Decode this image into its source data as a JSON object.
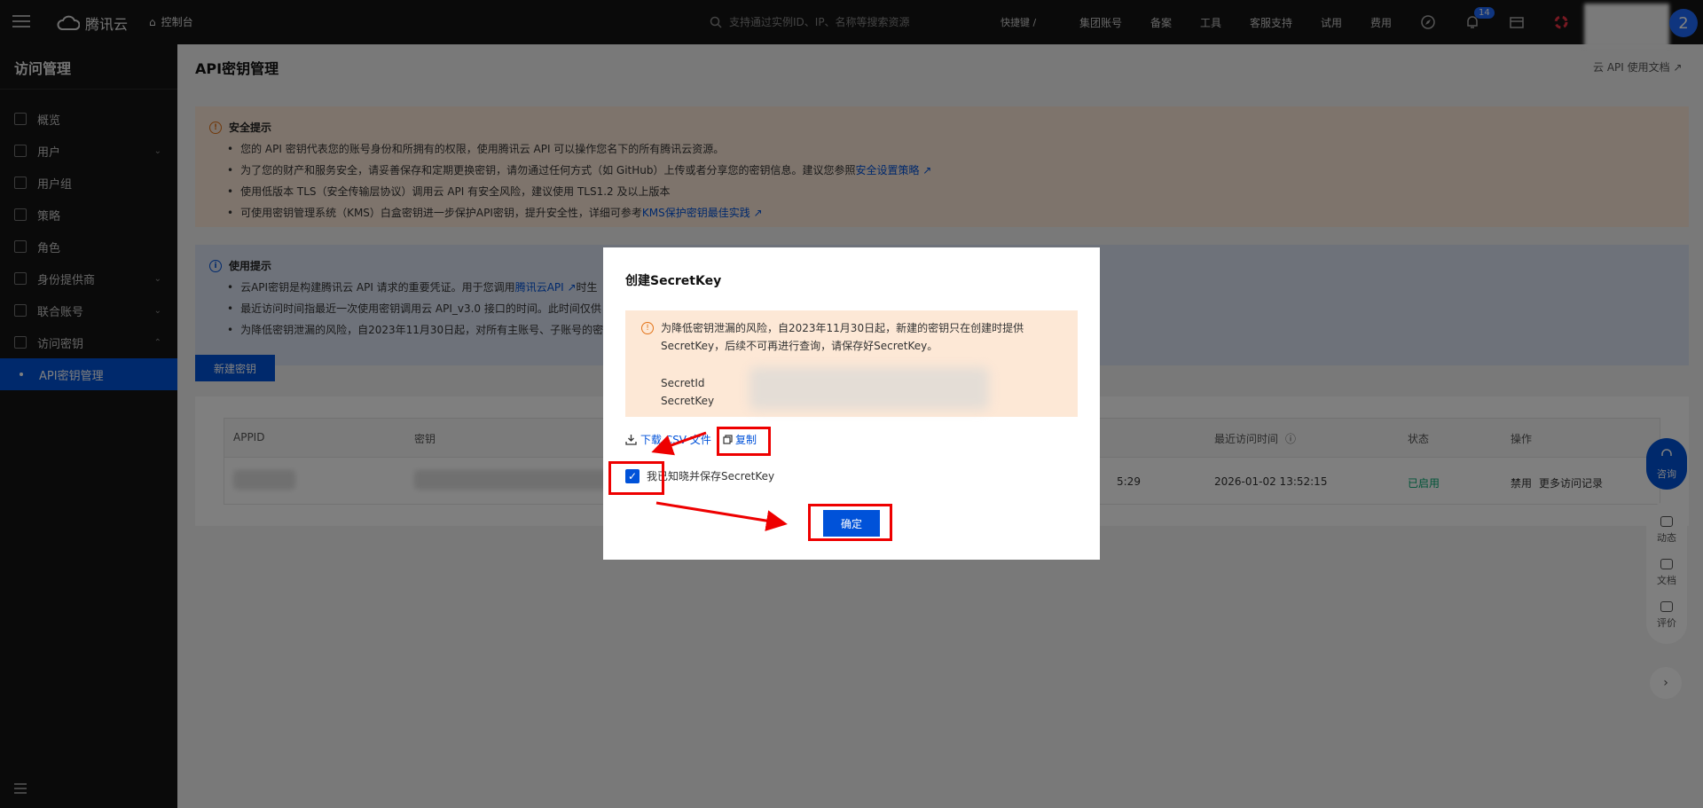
{
  "topbar": {
    "brand": "腾讯云",
    "console": "控制台",
    "search_placeholder": "支持通过实例ID、IP、名称等搜索资源",
    "shortcut": "快捷键 /",
    "nav": [
      "集团账号",
      "备案",
      "工具",
      "客服支持",
      "试用",
      "费用"
    ],
    "notification_count": "14",
    "avatar_initial": "2"
  },
  "sidebar": {
    "title": "访问管理",
    "items": [
      {
        "label": "概览",
        "icon": "grid-icon"
      },
      {
        "label": "用户",
        "icon": "user-icon",
        "expand": "⌄"
      },
      {
        "label": "用户组",
        "icon": "users-icon"
      },
      {
        "label": "策略",
        "icon": "policy-icon"
      },
      {
        "label": "角色",
        "icon": "role-icon"
      },
      {
        "label": "身份提供商",
        "icon": "idp-icon",
        "expand": "⌄"
      },
      {
        "label": "联合账号",
        "icon": "federation-icon",
        "expand": "⌄"
      },
      {
        "label": "访问密钥",
        "icon": "key-icon",
        "expand": "⌃"
      }
    ],
    "active_sub": "API密钥管理"
  },
  "page": {
    "title": "API密钥管理",
    "doc_link": "云 API 使用文档 ↗"
  },
  "security_notice": {
    "title": "安全提示",
    "lines": [
      "您的 API 密钥代表您的账号身份和所拥有的权限，使用腾讯云 API 可以操作您名下的所有腾讯云资源。",
      "为了您的财产和服务安全，请妥善保存和定期更换密钥，请勿通过任何方式（如 GitHub）上传或者分享您的密钥信息。建议您参照",
      "使用低版本 TLS（安全传输层协议）调用云 API 有安全风险，建议使用 TLS1.2 及以上版本",
      "可使用密钥管理系统（KMS）白盒密钥进一步保护API密钥，提升安全性，详细可参考"
    ],
    "link1": "安全设置策略 ↗",
    "link2": "KMS保护密钥最佳实践 ↗"
  },
  "usage_notice": {
    "title": "使用提示",
    "line1": "云API密钥是构建腾讯云 API 请求的重要凭证。用于您调用",
    "line1_link": "腾讯云API ↗",
    "line1_tail": "时生",
    "line2": "最近访问时间指最近一次使用密钥调用云 API_v3.0 接口的时间。此时间仅供",
    "line3": "为降低密钥泄漏的风险，自2023年11月30日起，对所有主账号、子账号的密"
  },
  "new_key_button": "新建密钥",
  "table": {
    "headers": [
      "APPID",
      "密钥",
      "最近访问时间",
      "状态",
      "操作"
    ],
    "row": {
      "created_tail": "5:29",
      "last_access": "2026-01-02 13:52:15",
      "status": "已启用",
      "action_disable": "禁用",
      "action_records": "更多访问记录"
    }
  },
  "float": {
    "consult": "咨询",
    "items": [
      "动态",
      "文档",
      "评价"
    ],
    "next": "›"
  },
  "modal": {
    "title": "创建SecretKey",
    "warning_line1": "为降低密钥泄漏的风险，自2023年11月30日起，新建的密钥只在创建时提供",
    "warning_line2": "SecretKey，后续不可再进行查询，请保存好SecretKey。",
    "secret_id_label": "SecretId",
    "secret_key_label": "SecretKey",
    "download_link": "下载 CSV 文件",
    "copy_link": "复制",
    "checkbox_label": "我已知晓并保存SecretKey",
    "checkbox_checked": true,
    "confirm": "确定"
  },
  "colors": {
    "primary": "#0052d9",
    "annotation": "#e00000",
    "success": "#00a870",
    "warn_bg": "#fde8d6"
  }
}
